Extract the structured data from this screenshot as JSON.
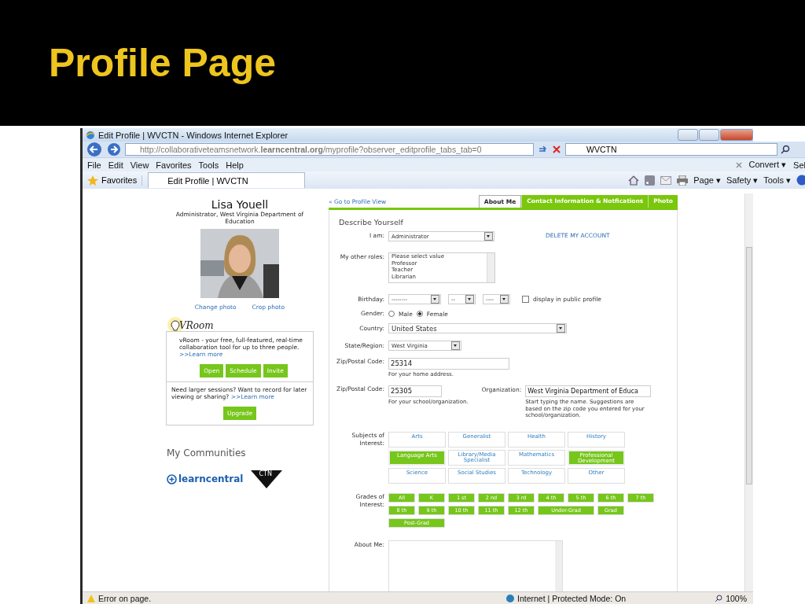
{
  "slide": {
    "title": "Profile Page"
  },
  "browser": {
    "title": "Edit Profile | WVCTN - Windows Internet Explorer",
    "address": "http://collaborativeteamsnetwork.**learncentral.org**/myprofile?observer_editprofile_tabs_tab=0",
    "search": "WVCTN",
    "menu": [
      "File",
      "Edit",
      "View",
      "Favorites",
      "Tools",
      "Help"
    ],
    "menu_right": [
      "Convert ▾",
      "Sel"
    ],
    "favorites": "Favorites",
    "tab": "Edit Profile | WVCTN",
    "commands": [
      "Page ▾",
      "Safety ▾",
      "Tools ▾"
    ],
    "status": "Error on page.",
    "zone": "Internet | Protected Mode: On",
    "zoom": "100%"
  },
  "profile": {
    "name": "Lisa Youell",
    "role": "Administrator, West Virginia Department of Education",
    "photo": {
      "kind": "picture"
    },
    "photo_links": [
      "Change photo",
      "Crop photo"
    ],
    "vroom": {
      "logo": "VRoom",
      "text": "vRoom - your free, full-featured, real-time collaboration tool for up to three people.",
      "link": ">>Learn more",
      "buttons": [
        "Open",
        "Schedule",
        "Invite"
      ],
      "upsell": "Need larger sessions? Want to record for later viewing or sharing?",
      "upsell_link": ">>Learn more",
      "upgrade": "Upgrade"
    },
    "communities_title": "My Communities",
    "communities": [
      {
        "kind": "learncentral",
        "name": "learncentral"
      },
      {
        "kind": "ctn",
        "name": "CTN"
      }
    ]
  },
  "form": {
    "back_link": "« Go to Profile View",
    "tabs": [
      {
        "label": "About Me",
        "selected": true
      },
      {
        "label": "Contact Information & Notfications",
        "selected": false
      },
      {
        "label": "Photo",
        "selected": false
      }
    ],
    "heading": "Describe Yourself",
    "i_am": {
      "label": "I am:",
      "value": "Administrator"
    },
    "delete": "DELETE MY ACCOUNT",
    "other_roles": {
      "label": "My other roles:",
      "options": [
        "Please select value",
        "Professor",
        "Teacher",
        "Librarian"
      ]
    },
    "birthday": {
      "label": "Birthday:",
      "selects": [
        "--------",
        "--",
        "----"
      ],
      "public": {
        "label": "display in public profile",
        "checked": false
      }
    },
    "gender": {
      "label": "Gender:",
      "options": [
        {
          "label": "Male",
          "selected": false
        },
        {
          "label": "Female",
          "selected": true
        }
      ]
    },
    "country": {
      "label": "Country:",
      "value": "United States"
    },
    "state": {
      "label": "State/Region:",
      "value": "West Virginia"
    },
    "home_zip": {
      "label": "Zip/Postal Code:",
      "value": "25314",
      "hint": "For your home address."
    },
    "school_zip": {
      "label": "Zip/Postal Code:",
      "value": "25305",
      "hint": "For your school/organization."
    },
    "organization": {
      "label": "Organization:",
      "value": "West Virginia Department of Educa",
      "hint": "Start typing the name. Suggestions are based on the zip code you entered for your school/organization."
    },
    "subjects": {
      "label": "Subjects of Interest:",
      "items": [
        {
          "label": "Arts",
          "selected": false
        },
        {
          "label": "Generalist",
          "selected": false
        },
        {
          "label": "Health",
          "selected": false
        },
        {
          "label": "History",
          "selected": false
        },
        {
          "label": "Language Arts",
          "selected": true
        },
        {
          "label": "Library/Media Specialist",
          "selected": false
        },
        {
          "label": "Mathematics",
          "selected": false
        },
        {
          "label": "Professional Development",
          "selected": true
        },
        {
          "label": "Science",
          "selected": false
        },
        {
          "label": "Social Studies",
          "selected": false
        },
        {
          "label": "Technology",
          "selected": false
        },
        {
          "label": "Other",
          "selected": false
        }
      ]
    },
    "grades": {
      "label": "Grades of Interest:",
      "items": [
        {
          "label": "All",
          "selected": true
        },
        {
          "label": "K",
          "selected": true
        },
        {
          "label": "1 st",
          "selected": true
        },
        {
          "label": "2 nd",
          "selected": true
        },
        {
          "label": "3 rd",
          "selected": true
        },
        {
          "label": "4 th",
          "selected": true
        },
        {
          "label": "5 th",
          "selected": true
        },
        {
          "label": "6 th",
          "selected": true
        },
        {
          "label": "7 th",
          "selected": true
        },
        {
          "label": "8 th",
          "selected": true
        },
        {
          "label": "9 th",
          "selected": true
        },
        {
          "label": "10 th",
          "selected": true
        },
        {
          "label": "11 th",
          "selected": true
        },
        {
          "label": "12 th",
          "selected": true
        },
        {
          "label": "Under-Grad",
          "selected": true
        },
        {
          "label": "Grad",
          "selected": true
        },
        {
          "label": "Post-Grad",
          "selected": true
        }
      ]
    },
    "about": {
      "label": "About Me:"
    }
  }
}
